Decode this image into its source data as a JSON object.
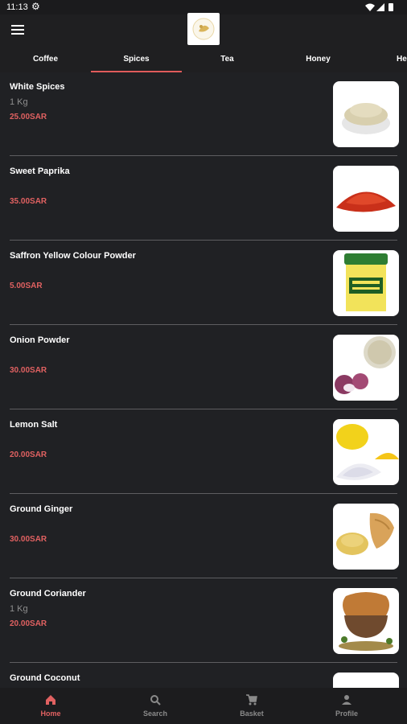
{
  "status_bar": {
    "time": "11:13"
  },
  "header": {
    "menu_icon": "hamburger-icon",
    "logo_icon": "store-logo"
  },
  "tabs": [
    {
      "label": "Coffee",
      "active": false
    },
    {
      "label": "Spices",
      "active": true
    },
    {
      "label": "Tea",
      "active": false
    },
    {
      "label": "Honey",
      "active": false
    },
    {
      "label": "He",
      "active": false
    }
  ],
  "products": [
    {
      "name": "White Spices",
      "qty": "1 Kg",
      "price": "25.00SAR",
      "image": "white-spice-powder-bowl"
    },
    {
      "name": "Sweet Paprika",
      "qty": "",
      "price": "35.00SAR",
      "image": "paprika-powder-pile"
    },
    {
      "name": "Saffron Yellow Colour Powder",
      "qty": "",
      "price": "5.00SAR",
      "image": "saffron-powder-jar"
    },
    {
      "name": "Onion Powder",
      "qty": "",
      "price": "30.00SAR",
      "image": "onions-and-powder"
    },
    {
      "name": "Lemon Salt",
      "qty": "",
      "price": "20.00SAR",
      "image": "lemons-and-salt"
    },
    {
      "name": "Ground Ginger",
      "qty": "",
      "price": "30.00SAR",
      "image": "ginger-root-and-powder"
    },
    {
      "name": "Ground Coriander",
      "qty": "1 Kg",
      "price": "20.00SAR",
      "image": "coriander-powder-bowl"
    },
    {
      "name": "Ground Coconut",
      "qty": "",
      "price": "",
      "image": "coconut-powder"
    }
  ],
  "bottom_nav": [
    {
      "label": "Home",
      "icon": "home-icon",
      "active": true
    },
    {
      "label": "Search",
      "icon": "search-icon",
      "active": false
    },
    {
      "label": "Basket",
      "icon": "cart-icon",
      "active": false
    },
    {
      "label": "Profile",
      "icon": "profile-icon",
      "active": false
    }
  ],
  "colors": {
    "accent": "#e06161",
    "background": "#202124",
    "divider": "#5e5e61"
  }
}
